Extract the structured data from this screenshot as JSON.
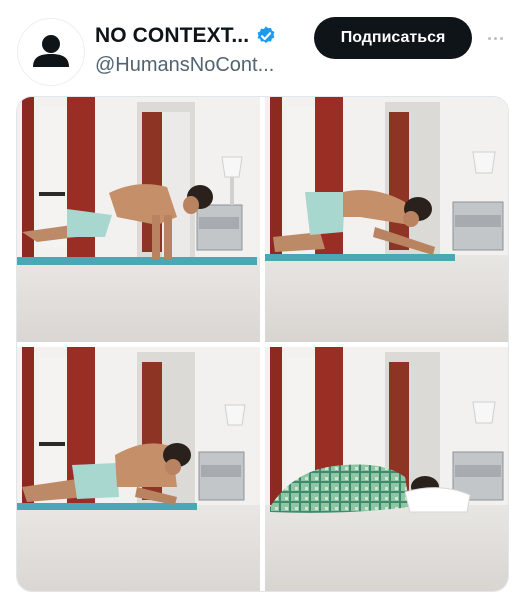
{
  "account": {
    "display_name": "NO CONTEXT...",
    "handle": "@HumansNoCont...",
    "avatar_icon": "person-silhouette-icon",
    "verified_icon": "verified-badge-icon",
    "verified_color": "#1d9bf0"
  },
  "actions": {
    "follow_label": "Подписаться",
    "more_icon": "more-dots-icon"
  },
  "media": {
    "panel_count": 4,
    "panels": [
      {
        "scene": "pushup-plank"
      },
      {
        "scene": "kneeling-plank"
      },
      {
        "scene": "collapsed-on-mat"
      },
      {
        "scene": "sleeping-under-blanket"
      }
    ]
  }
}
